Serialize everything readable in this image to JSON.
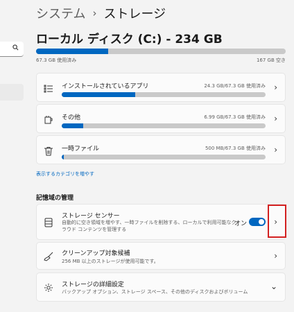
{
  "breadcrumb": {
    "parent": "システム",
    "separator": "›",
    "current": "ストレージ"
  },
  "disk": {
    "title": "ローカル ディスク (C:) - 234 GB",
    "used_label": "67.3 GB 使用済み",
    "free_label": "167 GB 空き",
    "used_fraction": 0.288
  },
  "categories": [
    {
      "icon": "apps-list-icon",
      "name": "インストールされているアプリ",
      "size": "24.3 GB/67.3 GB 使用済み",
      "fraction": 0.361
    },
    {
      "icon": "other-files-icon",
      "name": "その他",
      "size": "6.99 GB/67.3 GB 使用済み",
      "fraction": 0.104
    },
    {
      "icon": "trash-icon",
      "name": "一時ファイル",
      "size": "500 MB/67.3 GB 使用済み",
      "fraction": 0.007
    }
  ],
  "more_categories_link": "表示するカテゴリを増やす",
  "management": {
    "section_title": "記憶域の管理",
    "storage_sense": {
      "title": "ストレージ センサー",
      "desc_line1": "自動的に空き領域を増やす、一時ファイルを削除する、ローカルで利用可能なク",
      "desc_line2": "ラウド コンテンツを管理する",
      "toggle_label": "オン",
      "toggle_on": true
    },
    "cleanup": {
      "title": "クリーンアップ対象候補",
      "desc": "256 MB 以上のストレージが使用可能です。"
    },
    "advanced": {
      "title": "ストレージの詳細設定",
      "desc": "バックアップ オプション、ストレージ スペース、その他のディスクおよびボリューム"
    }
  },
  "colors": {
    "accent": "#0067c0",
    "highlight": "#d32020",
    "bar_track": "#c9c9c9"
  }
}
